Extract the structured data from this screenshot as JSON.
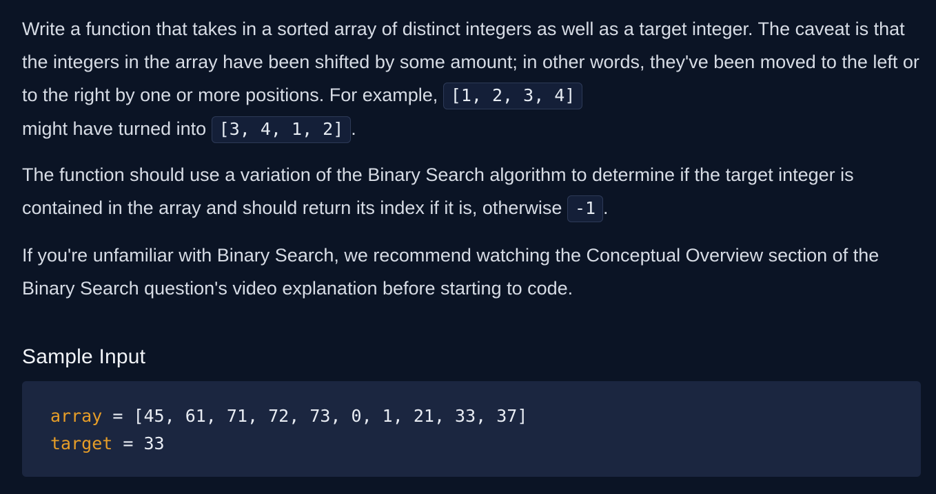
{
  "description": {
    "para1": {
      "text_before_code1": "Write a function that takes in a sorted array of distinct integers as well as a target integer. The caveat is that the integers in the array have been shifted by some amount; in other words, they've been moved to the left or to the right by one or more positions. For example, ",
      "code1": "[1, 2, 3, 4]",
      "text_between": " might have turned into ",
      "code2": "[3, 4, 1, 2]",
      "text_end": "."
    },
    "para2": {
      "text_before_code": "The function should use a variation of the Binary Search algorithm to determine if the target integer is contained in the array and should return its index if it is, otherwise ",
      "code": "-1",
      "text_end": "."
    },
    "para3": {
      "text": "If you're unfamiliar with Binary Search, we recommend watching the Conceptual Overview section of the Binary Search question's video explanation before starting to code."
    }
  },
  "sample_input": {
    "heading": "Sample Input",
    "lines": [
      {
        "name": "array",
        "operator": "=",
        "value": "[45, 61, 71, 72, 73, 0, 1, 21, 33, 37]"
      },
      {
        "name": "target",
        "operator": "=",
        "value": "33"
      }
    ]
  },
  "colors": {
    "background": "#0b1425",
    "code_block_background": "#1b2640",
    "inline_code_background": "#141f38",
    "variable_name": "#e69d28",
    "text": "#d7dce5"
  }
}
